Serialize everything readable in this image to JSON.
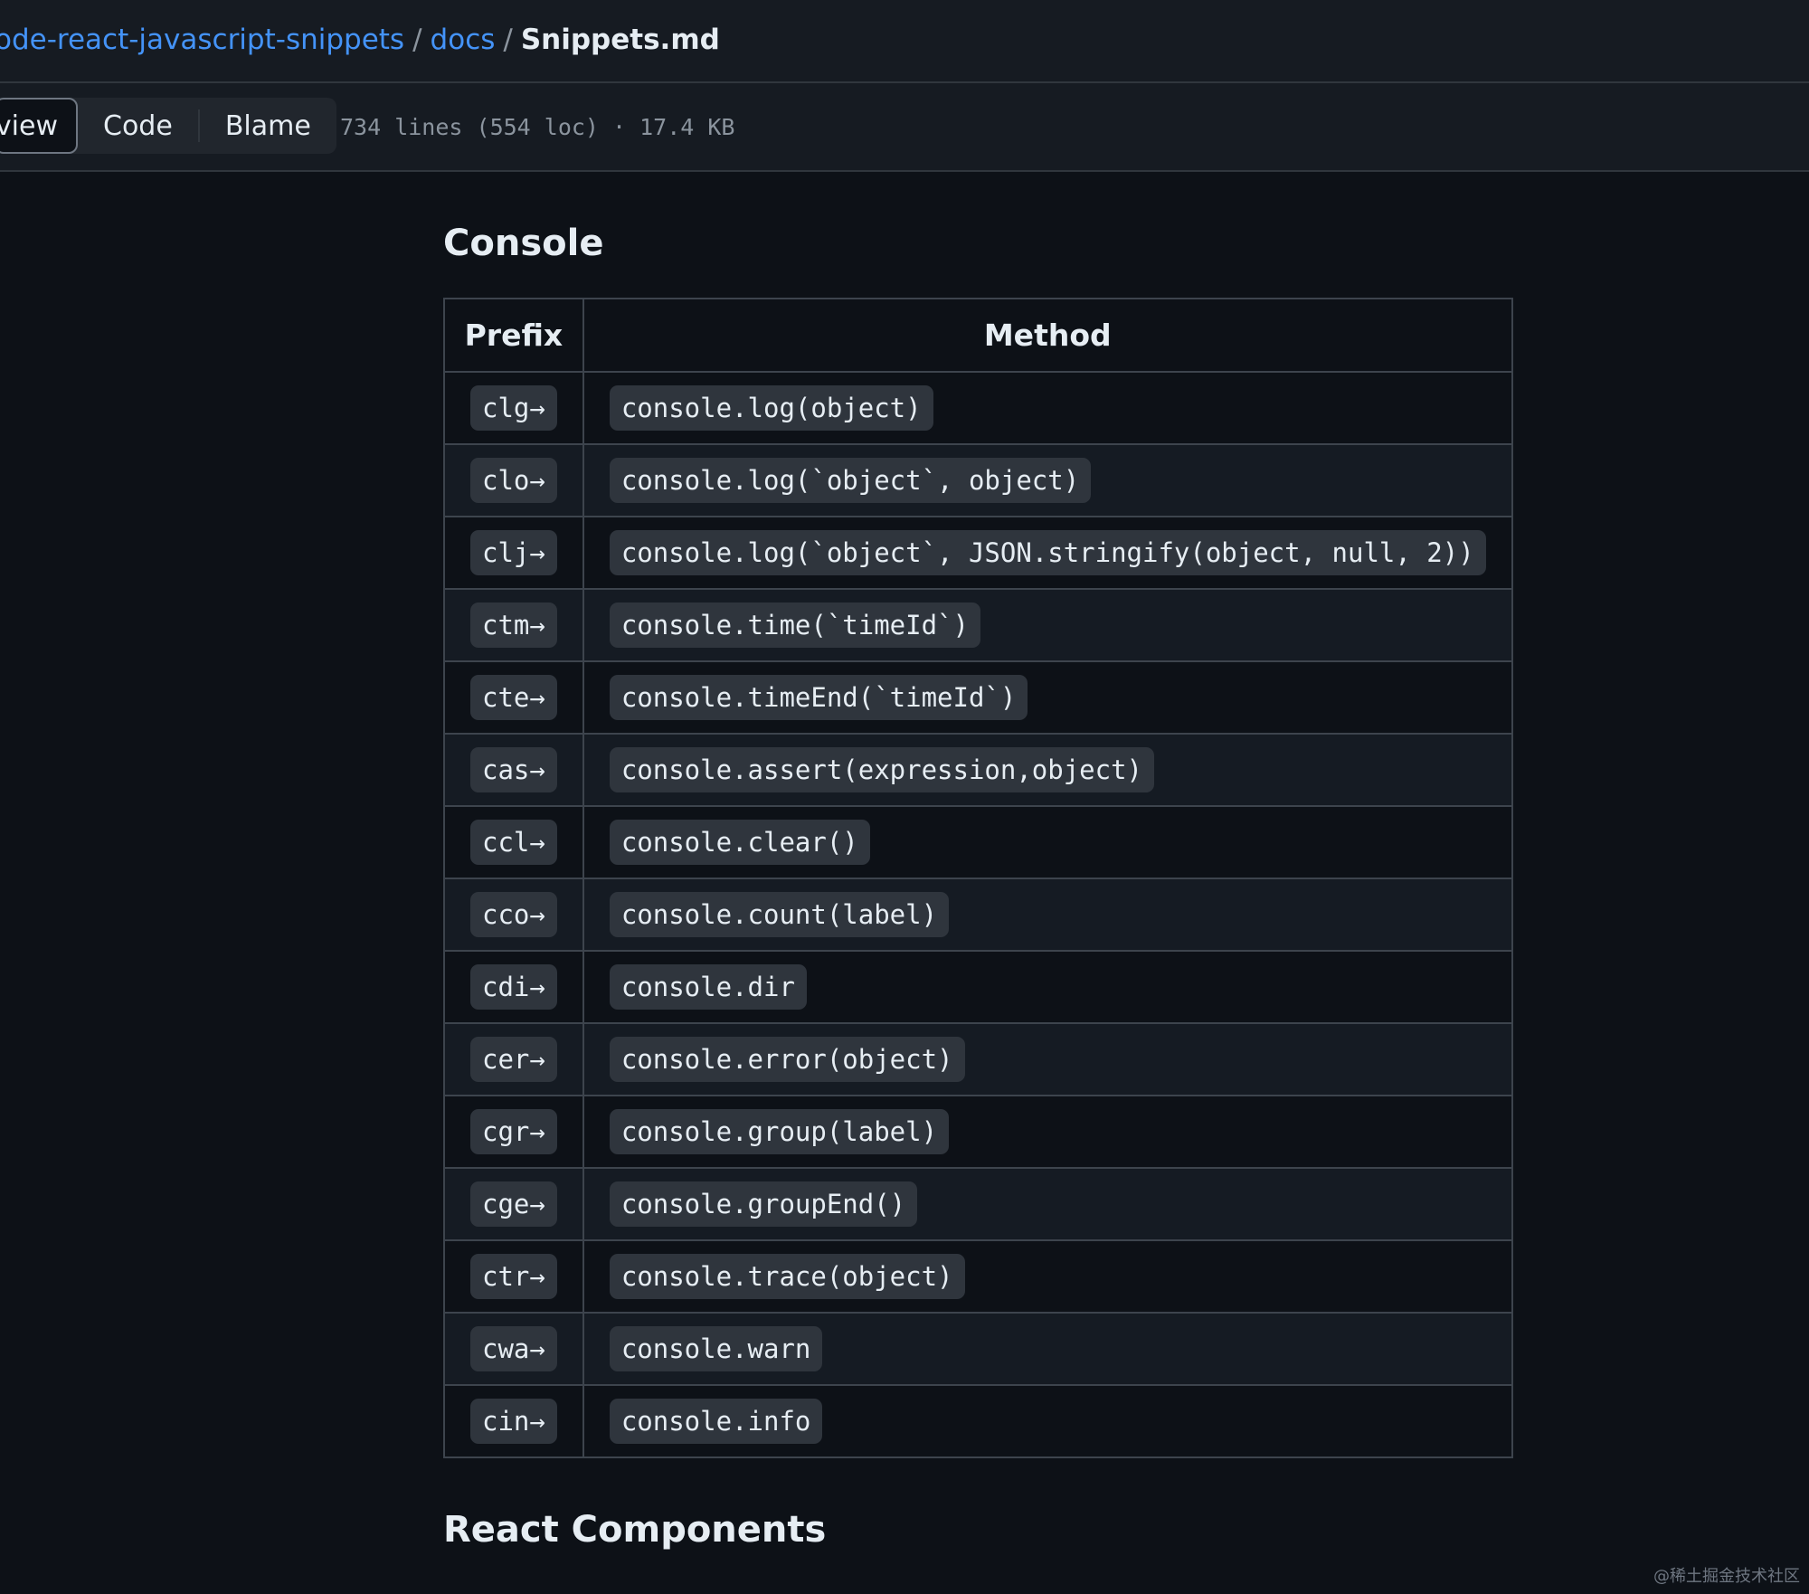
{
  "breadcrumb": {
    "repo": "ode-react-javascript-snippets",
    "folder": "docs",
    "file": "Snippets.md",
    "separator": "/"
  },
  "toolbar": {
    "tabs": [
      {
        "label": "view",
        "active": true
      },
      {
        "label": "Code",
        "active": false
      },
      {
        "label": "Blame",
        "active": false
      }
    ],
    "file_meta": "734 lines (554 loc) · 17.4 KB"
  },
  "sections": {
    "console_title": "Console",
    "react_title": "React Components"
  },
  "table": {
    "headers": [
      "Prefix",
      "Method"
    ],
    "rows": [
      {
        "prefix": "clg→",
        "method": "console.log(object)"
      },
      {
        "prefix": "clo→",
        "method": "console.log(`object`, object)"
      },
      {
        "prefix": "clj→",
        "method": "console.log(`object`, JSON.stringify(object, null, 2))"
      },
      {
        "prefix": "ctm→",
        "method": "console.time(`timeId`)"
      },
      {
        "prefix": "cte→",
        "method": "console.timeEnd(`timeId`)"
      },
      {
        "prefix": "cas→",
        "method": "console.assert(expression,object)"
      },
      {
        "prefix": "ccl→",
        "method": "console.clear()"
      },
      {
        "prefix": "cco→",
        "method": "console.count(label)"
      },
      {
        "prefix": "cdi→",
        "method": "console.dir"
      },
      {
        "prefix": "cer→",
        "method": "console.error(object)"
      },
      {
        "prefix": "cgr→",
        "method": "console.group(label)"
      },
      {
        "prefix": "cge→",
        "method": "console.groupEnd()"
      },
      {
        "prefix": "ctr→",
        "method": "console.trace(object)"
      },
      {
        "prefix": "cwa→",
        "method": "console.warn"
      },
      {
        "prefix": "cin→",
        "method": "console.info"
      }
    ]
  },
  "watermark": "@稀土掘金技术社区",
  "colors": {
    "background": "#0d1117",
    "header_background": "#161b22",
    "link": "#4493f8",
    "code_background": "#2f353d",
    "border": "#3d444d"
  }
}
